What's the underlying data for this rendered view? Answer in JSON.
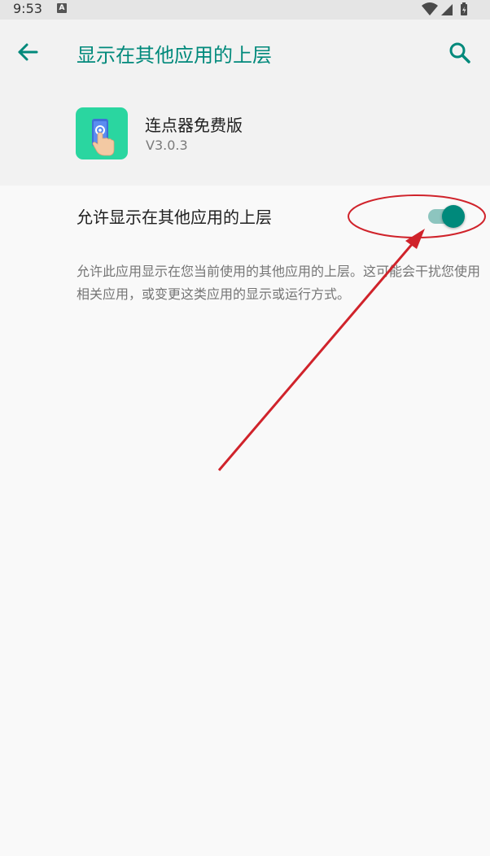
{
  "status_bar": {
    "time": "9:53",
    "notification_icon": "A",
    "icons": [
      "wifi-icon",
      "signal-icon",
      "battery-icon"
    ]
  },
  "toolbar": {
    "back_icon": "arrow-back-icon",
    "title": "显示在其他应用的上层",
    "search_icon": "search-icon"
  },
  "app": {
    "name": "连点器免费版",
    "version": "V3.0.3",
    "icon": "tap-hand-phone-icon"
  },
  "setting": {
    "label": "允许显示在其他应用的上层",
    "enabled": true,
    "description": "允许此应用显示在您当前使用的其他应用的上层。这可能会干扰您使用相关应用，或变更这类应用的显示或运行方式。"
  },
  "colors": {
    "accent": "#00897b",
    "toggle_track": "#8dc5bf",
    "app_icon_bg": "#2ad6a0",
    "annotation": "#d0232b"
  }
}
